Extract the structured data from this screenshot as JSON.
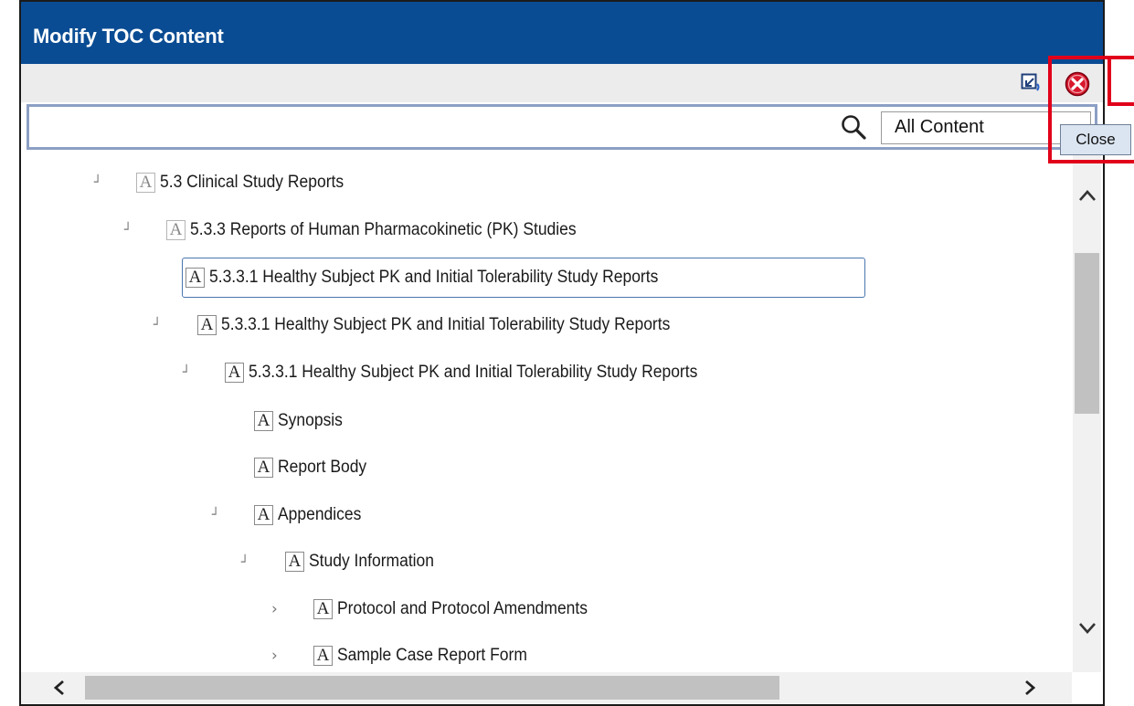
{
  "dialog": {
    "title": "Modify TOC Content",
    "close_tooltip": "Close"
  },
  "search": {
    "value": "",
    "placeholder": "",
    "filter_selected": "All Content"
  },
  "tree": {
    "badge_letter": "A",
    "nodes": [
      {
        "label": "5.3 Clinical Study Reports",
        "twisty": "expanded"
      },
      {
        "label": "5.3.3 Reports of Human Pharmacokinetic (PK) Studies",
        "twisty": "expanded"
      },
      {
        "label": "5.3.3.1 Healthy Subject PK and Initial Tolerability Study Reports",
        "twisty": "none",
        "selected": true
      },
      {
        "label": "5.3.3.1 Healthy Subject PK and Initial Tolerability Study Reports",
        "twisty": "expanded"
      },
      {
        "label": "5.3.3.1 Healthy Subject PK and Initial Tolerability Study Reports",
        "twisty": "expanded"
      },
      {
        "label": "Synopsis",
        "twisty": "none"
      },
      {
        "label": "Report Body",
        "twisty": "none"
      },
      {
        "label": "Appendices",
        "twisty": "expanded"
      },
      {
        "label": "Study Information",
        "twisty": "expanded"
      },
      {
        "label": "Protocol and Protocol Amendments",
        "twisty": "collapsed"
      },
      {
        "label": "Sample Case Report Form",
        "twisty": "collapsed"
      }
    ]
  },
  "colors": {
    "titlebar": "#0a4c93",
    "highlight": "#e1001a",
    "close_icon": "#d9182d"
  },
  "icons": {
    "close": "close-circle-icon",
    "restore": "restore-window-icon",
    "search": "search-icon"
  }
}
